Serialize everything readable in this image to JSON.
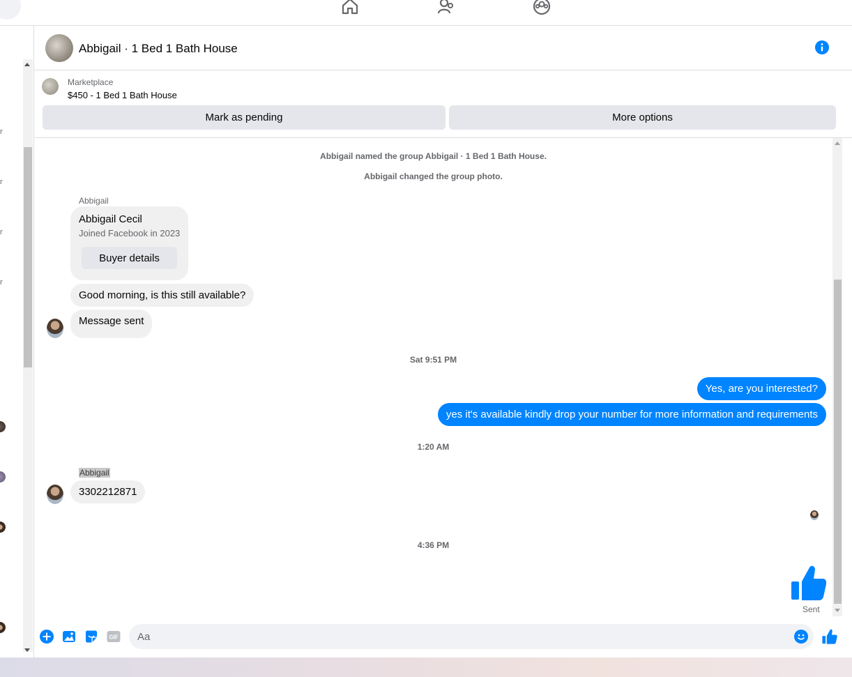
{
  "chat": {
    "title": "Abbigail · 1 Bed 1 Bath House"
  },
  "marketplace": {
    "label": "Marketplace",
    "listing": "$450 - 1 Bed 1 Bath House",
    "mark_pending": "Mark as pending",
    "more_options": "More options"
  },
  "messages": {
    "sys_named": "Abbigail named the group Abbigail · 1 Bed 1 Bath House.",
    "sys_photo": "Abbigail changed the group photo.",
    "sender1": "Abbigail",
    "card_name": "Abbigail Cecil",
    "card_sub": "Joined Facebook in 2023",
    "buyer_details": "Buyer details",
    "msg_available": "Good morning, is this still available?",
    "msg_sent": "Message sent",
    "time1": "Sat 9:51 PM",
    "out1": "Yes, are you interested?",
    "out2": "yes it's available kindly drop your number for more information and requirements",
    "time2": "1:20 AM",
    "sender2": "Abbigail",
    "phone": "3302212871",
    "time3": "4:36 PM",
    "sent_status": "Sent"
  },
  "composer": {
    "placeholder": "Aa"
  },
  "colors": {
    "accent": "#0084ff",
    "bubble_in": "#f0f0f0",
    "button_bg": "#e4e6eb"
  }
}
